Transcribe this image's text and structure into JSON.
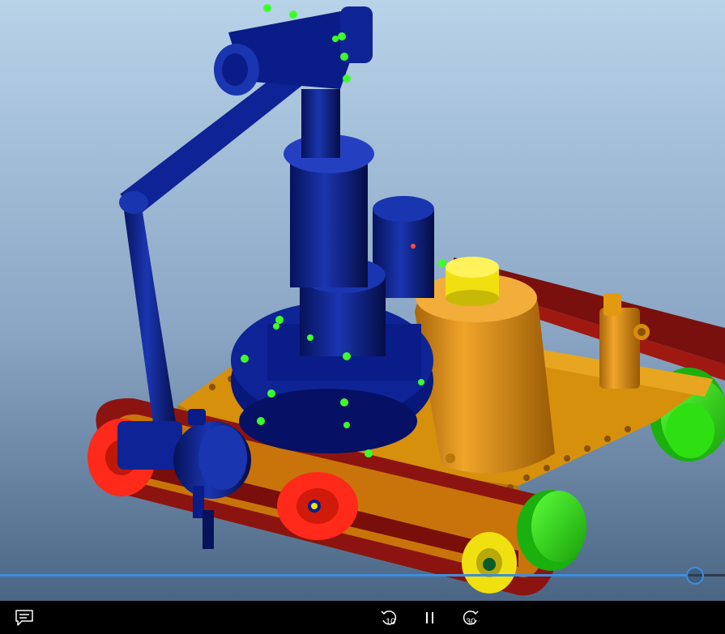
{
  "player": {
    "progress_fraction": 0.958,
    "skip_back_seconds": "10",
    "skip_forward_seconds": "30"
  },
  "colors": {
    "accent": "#3a8fe0",
    "scene_bg_top": "#b4cfe6",
    "scene_bg_bottom": "#4f6b8a",
    "robot_blue": "#0a1f86",
    "chassis_orange": "#e39a10",
    "track_red": "#8c1410",
    "wheel_green": "#2ee012",
    "wheel_red": "#ff2a1a",
    "wheel_yellow": "#f0e010"
  },
  "icons": {
    "captions": "captions-icon",
    "skip_back": "skip-back-icon",
    "play_pause": "pause-icon",
    "skip_forward": "skip-forward-icon"
  }
}
